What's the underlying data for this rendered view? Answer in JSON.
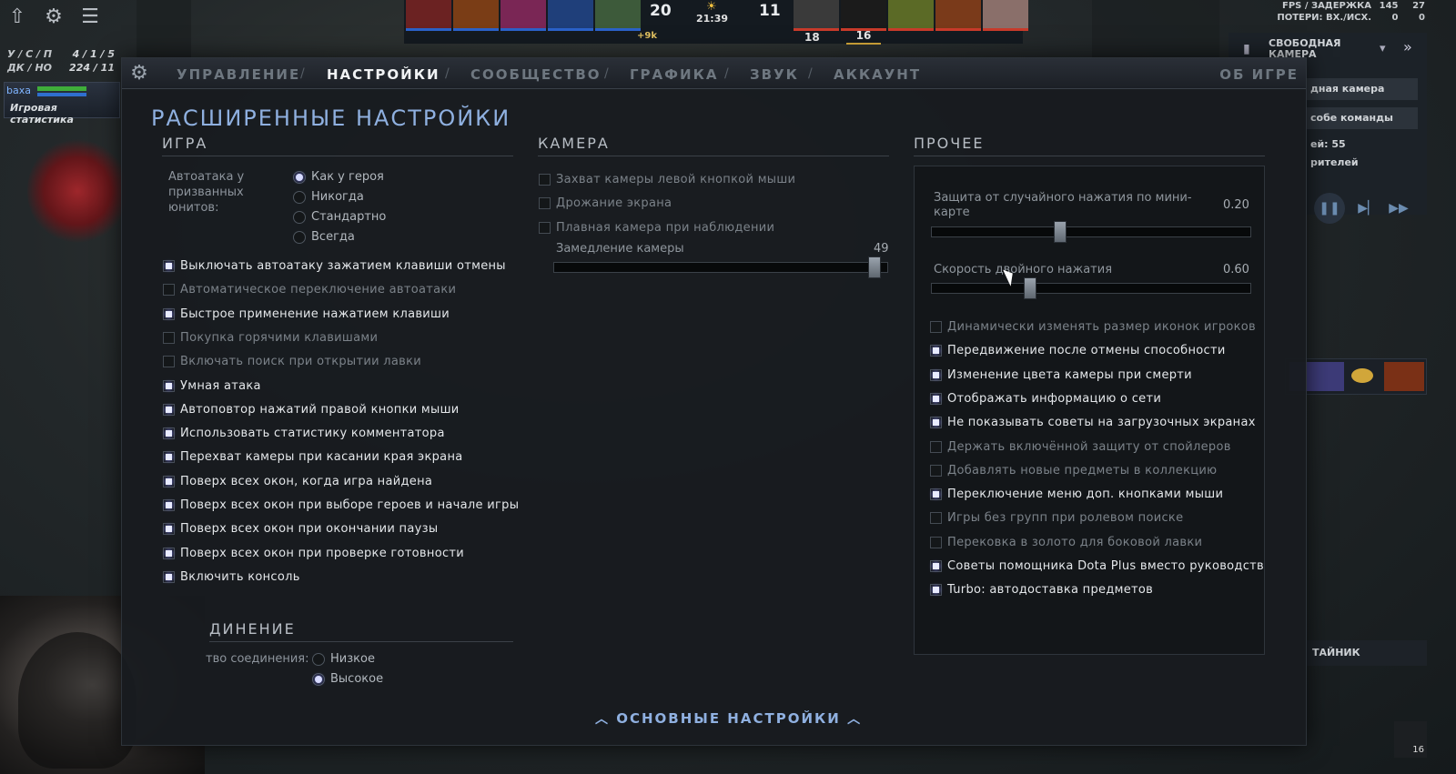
{
  "hud": {
    "kda_label": "У / С / П",
    "kda_value": "4 / 1 / 5",
    "dn_label": "ДК / НО",
    "dn_value": "224 / 11",
    "player_name": "baxa",
    "stats_title": "Игровая статистика",
    "score_left": "20",
    "score_right": "11",
    "clock": "21:39",
    "gold_diff": "+9k",
    "num18": "18",
    "num16": "16",
    "fps_line1_label": "FPS / ЗАДЕРЖКА",
    "fps_line1_v1": "145",
    "fps_line1_v2": "27",
    "fps_line2_label": "ПОТЕРИ: ВХ./ИСХ.",
    "fps_line2_v1": "0",
    "fps_line2_v2": "0"
  },
  "spectator": {
    "camera_label": "СВОБОДНАЯ КАМЕРА",
    "row1": "дная камера",
    "row2": "собе команды",
    "txt1": "ей: 55",
    "txt2": "рителей",
    "cache": "ТАЙНИК",
    "bottom_num": "16"
  },
  "tabs": {
    "items": [
      "УПРАВЛЕНИЕ",
      "НАСТРОЙКИ",
      "СООБЩЕСТВО",
      "ГРАФИКА",
      "ЗВУК",
      "АККАУНТ"
    ],
    "active": "НАСТРОЙКИ",
    "about": "ОБ ИГРЕ"
  },
  "title": "РАСШИРЕННЫЕ НАСТРОЙКИ",
  "game": {
    "title": "ИГРА",
    "autoattack_label": "Автоатака у призванных юнитов:",
    "autoattack_options": [
      "Как у героя",
      "Никогда",
      "Стандартно",
      "Всегда"
    ],
    "autoattack_selected": "Как у героя",
    "checkboxes": [
      {
        "label": "Выключать автоатаку зажатием клавиши отмены",
        "checked": true
      },
      {
        "label": "Автоматическое переключение автоатаки",
        "checked": false
      },
      {
        "label": "Быстрое применение нажатием клавиши",
        "checked": true
      },
      {
        "label": "Покупка горячими клавишами",
        "checked": false
      },
      {
        "label": "Включать поиск при открытии лавки",
        "checked": false
      },
      {
        "label": "Умная атака",
        "checked": true
      },
      {
        "label": "Автоповтор нажатий правой кнопки мыши",
        "checked": true
      },
      {
        "label": "Использовать статистику комментатора",
        "checked": true
      },
      {
        "label": "Перехват камеры при касании края экрана",
        "checked": true
      },
      {
        "label": "Поверх всех окон, когда игра найдена",
        "checked": true
      },
      {
        "label": "Поверх всех окон при выборе героев и начале игры",
        "checked": true
      },
      {
        "label": "Поверх всех окон при окончании паузы",
        "checked": true
      },
      {
        "label": "Поверх всех окон при проверке готовности",
        "checked": true
      },
      {
        "label": "Включить консоль",
        "checked": true
      }
    ]
  },
  "connection": {
    "title": "ДИНЕНИЕ",
    "label": "тво соединения:",
    "options": [
      "Низкое",
      "Высокое"
    ],
    "selected": "Высокое"
  },
  "camera": {
    "title": "КАМЕРА",
    "checkboxes": [
      {
        "label": "Захват камеры левой кнопкой мыши",
        "checked": false
      },
      {
        "label": "Дрожание экрана",
        "checked": false
      },
      {
        "label": "Плавная камера при наблюдении",
        "checked": false
      }
    ],
    "slider_label": "Замедление камеры",
    "slider_value": "49",
    "slider_fraction": 0.98
  },
  "other": {
    "title": "ПРОЧЕЕ",
    "slider1_label": "Защита от случайного нажатия по мини-карте",
    "slider1_value": "0.20",
    "slider1_fraction": 0.4,
    "slider2_label": "Скорость двойного нажатия",
    "slider2_value": "0.60",
    "slider2_fraction": 0.3,
    "checkboxes": [
      {
        "label": "Динамически изменять размер иконок игроков",
        "checked": false
      },
      {
        "label": "Передвижение после отмены способности",
        "checked": true
      },
      {
        "label": "Изменение цвета камеры при смерти",
        "checked": true
      },
      {
        "label": "Отображать информацию о сети",
        "checked": true
      },
      {
        "label": "Не показывать советы на загрузочных экранах",
        "checked": true
      },
      {
        "label": "Держать включённой защиту от спойлеров",
        "checked": false
      },
      {
        "label": "Добавлять новые предметы в коллекцию",
        "checked": false
      },
      {
        "label": "Переключение меню доп. кнопками мыши",
        "checked": true
      },
      {
        "label": "Игры без групп при ролевом поиске",
        "checked": false
      },
      {
        "label": "Перековка в золото для боковой лавки",
        "checked": false
      },
      {
        "label": "Советы помощника Dota Plus вместо руководств",
        "checked": true
      },
      {
        "label": "Turbo: автодоставка предметов",
        "checked": true
      }
    ]
  },
  "basic_settings": "ОСНОВНЫЕ НАСТРОЙКИ",
  "colors": {
    "accent": "#8fb0e0",
    "panel_bg": "#181b1f",
    "checked_glow": "#8a8fff"
  }
}
